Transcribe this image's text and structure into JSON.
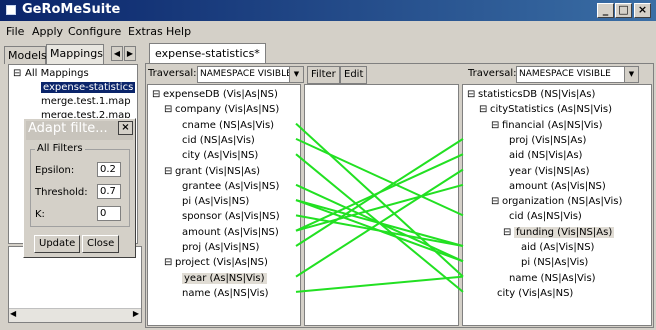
{
  "window": {
    "title": "GeRoMeSuite",
    "btn_min": "_",
    "btn_max": "□",
    "btn_close": "×"
  },
  "menu": [
    "File",
    "Apply",
    "Configure",
    "Extras",
    "Help"
  ],
  "left": {
    "tabs": [
      "Models",
      "Mappings"
    ],
    "arrows": [
      "◀",
      "▶"
    ],
    "tree": {
      "root": "All Mappings",
      "items": [
        "expense-statistics",
        "merge.test.1.map",
        "merge.test.2.map"
      ]
    }
  },
  "dialog": {
    "title": "Adapt filte...",
    "close": "×",
    "group_label": "All Filters",
    "epsilon_label": "Epsilon:",
    "epsilon_value": "0.2",
    "threshold_label": "Threshold:",
    "threshold_value": "0.7",
    "k_label": "K:",
    "k_value": "0",
    "update_label": "Update",
    "close_label": "Close"
  },
  "editor": {
    "tab_label": "expense-statistics*",
    "traversal_label": "Traversal:",
    "left_traversal": "NAMESPACE VISIBLE",
    "right_traversal": "NAMESPACE VISIBLE",
    "filter_label": "Filter",
    "edit_label": "Edit",
    "left_tree": [
      {
        "label": "expenseDB (Vis|As|NS)",
        "level": 0,
        "toggle": "⊟"
      },
      {
        "label": "company (Vis|As|NS)",
        "level": 1,
        "toggle": "⊟"
      },
      {
        "label": "cname (NS|As|Vis)",
        "level": 2
      },
      {
        "label": "cid (NS|As|Vis)",
        "level": 2
      },
      {
        "label": "city (As|Vis|NS)",
        "level": 2
      },
      {
        "label": "grant (Vis|NS|As)",
        "level": 1,
        "toggle": "⊟"
      },
      {
        "label": "grantee (As|Vis|NS)",
        "level": 2
      },
      {
        "label": "pi (As|Vis|NS)",
        "level": 2
      },
      {
        "label": "sponsor (As|Vis|NS)",
        "level": 2
      },
      {
        "label": "amount (As|Vis|NS)",
        "level": 2
      },
      {
        "label": "proj (As|Vis|NS)",
        "level": 2
      },
      {
        "label": "project (Vis|As|NS)",
        "level": 1,
        "toggle": "⊟"
      },
      {
        "label": "year (As|NS|Vis)",
        "level": 2,
        "selected": true
      },
      {
        "label": "name (As|NS|Vis)",
        "level": 2
      }
    ],
    "right_tree": [
      {
        "label": "statisticsDB (NS|Vis|As)",
        "level": 0,
        "toggle": "⊟"
      },
      {
        "label": "cityStatistics (As|NS|Vis)",
        "level": 1,
        "toggle": "⊟"
      },
      {
        "label": "financial (As|NS|Vis)",
        "level": 2,
        "toggle": "⊟"
      },
      {
        "label": "proj (Vis|NS|As)",
        "level": 3
      },
      {
        "label": "aid (NS|Vis|As)",
        "level": 3
      },
      {
        "label": "year (Vis|NS|As)",
        "level": 3
      },
      {
        "label": "amount (As|Vis|NS)",
        "level": 3
      },
      {
        "label": "organization (NS|As|Vis)",
        "level": 2,
        "toggle": "⊟"
      },
      {
        "label": "cid (As|NS|Vis)",
        "level": 3
      },
      {
        "label": "funding (Vis|NS|As)",
        "level": 3,
        "toggle": "⊟",
        "selected": true
      },
      {
        "label": "aid (As|Vis|NS)",
        "level": 4
      },
      {
        "label": "pi (NS|As|Vis)",
        "level": 4
      },
      {
        "label": "name (NS|As|Vis)",
        "level": 3
      },
      {
        "label": "city (Vis|As|NS)",
        "level": 2
      }
    ],
    "links": [
      [
        2,
        12
      ],
      [
        3,
        8
      ],
      [
        4,
        13
      ],
      [
        6,
        11
      ],
      [
        7,
        11
      ],
      [
        8,
        10
      ],
      [
        9,
        6
      ],
      [
        10,
        3
      ],
      [
        12,
        5
      ],
      [
        13,
        12
      ],
      [
        9,
        4
      ],
      [
        7,
        10
      ]
    ],
    "link_color": "#22e022"
  }
}
